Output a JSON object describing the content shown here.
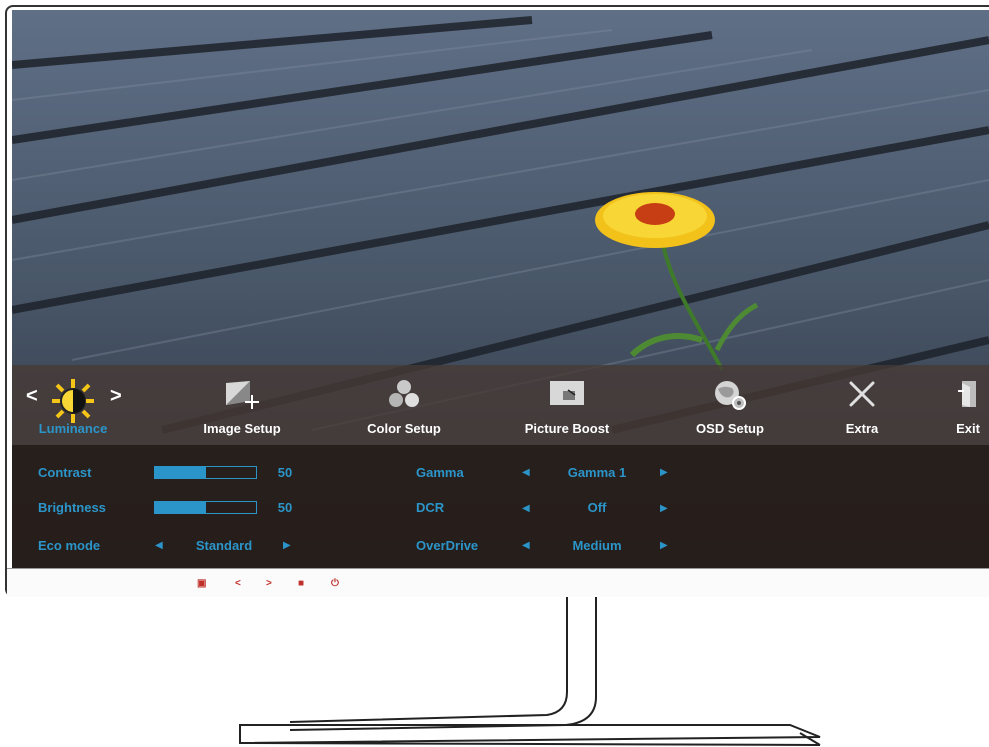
{
  "osd": {
    "tabs": [
      {
        "label": "Luminance",
        "icon": "sun-contrast-icon",
        "active": true
      },
      {
        "label": "Image Setup",
        "icon": "image-setup-icon",
        "active": false
      },
      {
        "label": "Color Setup",
        "icon": "color-balls-icon",
        "active": false
      },
      {
        "label": "Picture Boost",
        "icon": "picture-boost-icon",
        "active": false
      },
      {
        "label": "OSD Setup",
        "icon": "globe-gear-icon",
        "active": false
      },
      {
        "label": "Extra",
        "icon": "tools-icon",
        "active": false
      },
      {
        "label": "Exit",
        "icon": "exit-door-icon",
        "active": false
      }
    ],
    "nav_left": "<",
    "nav_right": ">",
    "settings": {
      "contrast": {
        "label": "Contrast",
        "value": "50",
        "level": 0.5
      },
      "brightness": {
        "label": "Brightness",
        "value": "50",
        "level": 0.5
      },
      "eco_mode": {
        "label": "Eco mode",
        "value": "Standard"
      },
      "gamma": {
        "label": "Gamma",
        "value": "Gamma 1"
      },
      "dcr": {
        "label": "DCR",
        "value": "Off"
      },
      "overdrive": {
        "label": "OverDrive",
        "value": "Medium"
      }
    },
    "accent_color": "#2b95c9"
  },
  "bezel_buttons": [
    "menu-icon",
    "left-icon",
    "right-icon",
    "source-icon",
    "power-icon"
  ]
}
